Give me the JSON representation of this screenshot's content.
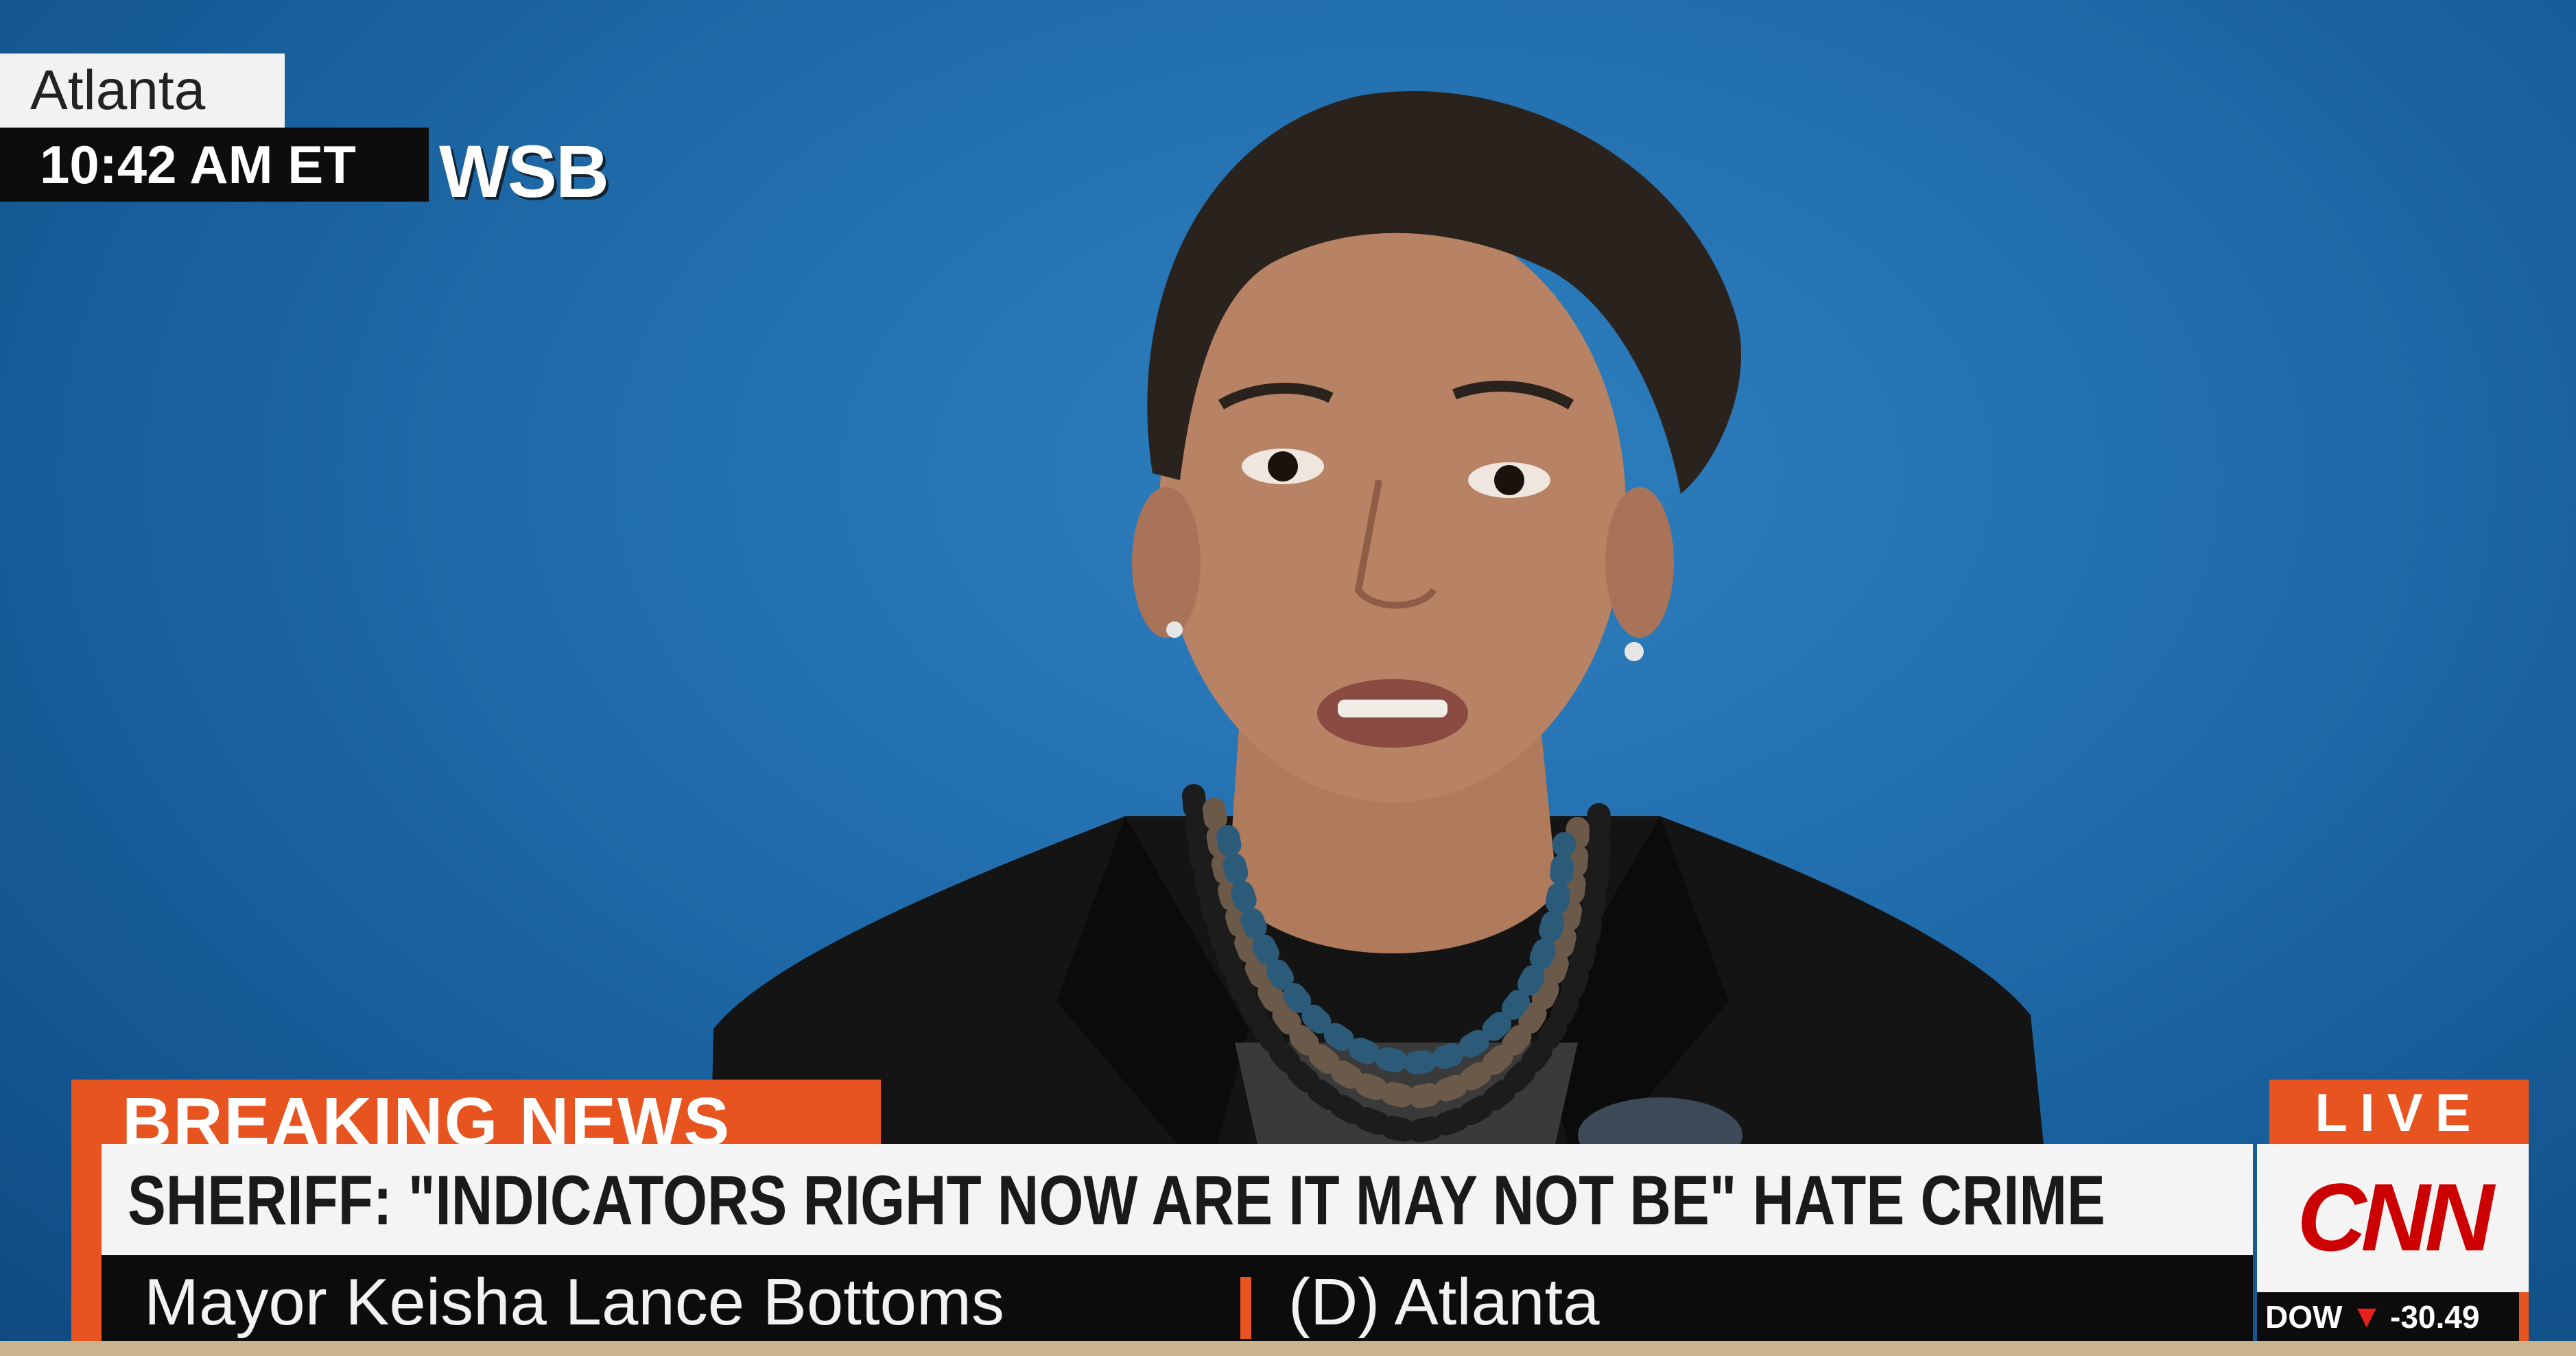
{
  "location_bug": {
    "location": "Atlanta",
    "time": "10:42 AM ET",
    "affiliate": "WSB"
  },
  "lower_third": {
    "banner": "BREAKING NEWS",
    "headline": "SHERIFF: \"INDICATORS RIGHT NOW ARE IT MAY NOT BE\" HATE CRIME",
    "speaker_name": "Mayor Keisha Lance Bottoms",
    "speaker_affiliation": "(D) Atlanta"
  },
  "network_bug": {
    "live_label": "LIVE",
    "logo": "CNN",
    "ticker_label": "DOW",
    "ticker_direction_icon": "down-triangle-icon",
    "ticker_value": "-30.49"
  },
  "colors": {
    "accent_orange": "#e8541f",
    "cnn_red": "#cc0000",
    "background_blue": "#2370b0"
  }
}
